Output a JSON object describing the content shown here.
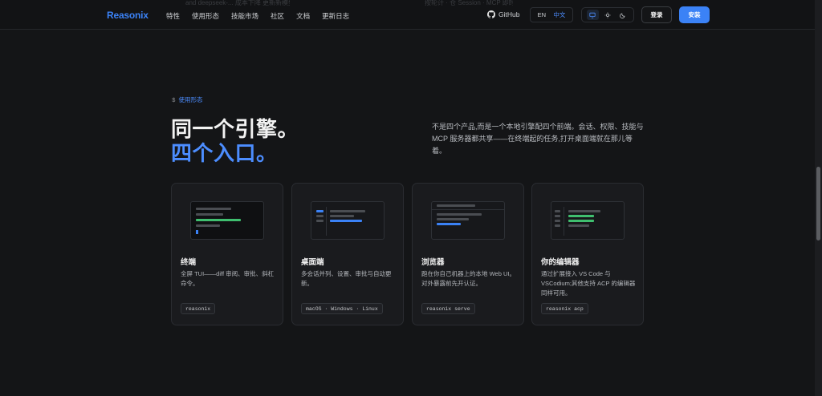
{
  "header": {
    "logo": "Reasonix",
    "nav": [
      "特性",
      "使用形态",
      "技能市场",
      "社区",
      "文档",
      "更新日志"
    ],
    "github": "GitHub",
    "lang_en": "EN",
    "lang_zh": "中文",
    "login": "登录",
    "install": "安装",
    "faded_left": "and deepseek-...  成本下降 更新新模型下载。",
    "faded_right": "按轮计 · 仓 Session · MCP 即时  公开开发"
  },
  "section": {
    "eyebrow_symbol": "$",
    "eyebrow": "使用形态",
    "title_line1": "同一个引擎。",
    "title_line2": "四个入口。",
    "description": "不是四个产品,而是一个本地引擎配四个前端。会话、权限、技能与 MCP 服务器都共享——在终端起的任务,打开桌面端就在那儿等着。"
  },
  "cards": [
    {
      "title": "终端",
      "desc": "全屏 TUI——diff 审阅、审批、斜杠命令。",
      "code": "reasonix"
    },
    {
      "title": "桌面端",
      "desc": "多会话并列、设置、审批与自动更新。",
      "code": "macOS · Windows · Linux"
    },
    {
      "title": "浏览器",
      "desc": "跑在你自己机器上的本地 Web UI。对外暴露前先开认证。",
      "code": "reasonix serve"
    },
    {
      "title": "你的编辑器",
      "desc": "通过扩展接入 VS Code 与 VSCodium;其他支持 ACP 的编辑器同样可用。",
      "code": "reasonix acp"
    }
  ],
  "colors": {
    "accent": "#3b82f6",
    "background": "#141517",
    "green": "#3fbf6f"
  }
}
